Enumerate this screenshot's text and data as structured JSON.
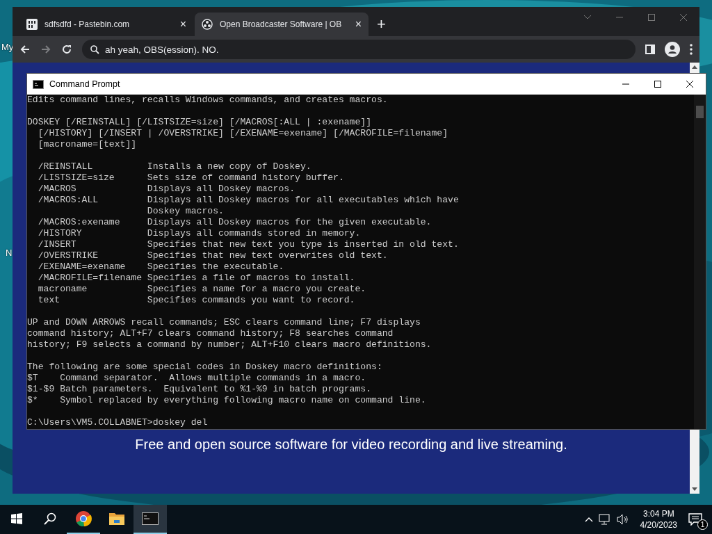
{
  "desktop": {
    "icon_labels": [
      "My",
      "N"
    ]
  },
  "browser": {
    "tabs": [
      {
        "title": "sdfsdfd - Pastebin.com",
        "selected": false,
        "close": "×"
      },
      {
        "title": "Open Broadcaster Software | OB",
        "selected": true,
        "close": "×"
      }
    ],
    "new_tab": "+",
    "address": {
      "value": "ah yeah, OBS(ession). NO."
    },
    "page": {
      "tagline": "Free and open source software for video recording and live streaming."
    }
  },
  "cmd": {
    "title": "Command Prompt",
    "blocks": [
      [
        "Edits command lines, recalls Windows commands, and creates macros."
      ],
      [
        "DOSKEY [/REINSTALL] [/LISTSIZE=size] [/MACROS[:ALL | :exename]]",
        "  [/HISTORY] [/INSERT | /OVERSTRIKE] [/EXENAME=exename] [/MACROFILE=filename]",
        "  [macroname=[text]]"
      ],
      [
        "  /REINSTALL          Installs a new copy of Doskey.",
        "  /LISTSIZE=size      Sets size of command history buffer.",
        "  /MACROS             Displays all Doskey macros.",
        "  /MACROS:ALL         Displays all Doskey macros for all executables which have",
        "                      Doskey macros.",
        "  /MACROS:exename     Displays all Doskey macros for the given executable.",
        "  /HISTORY            Displays all commands stored in memory.",
        "  /INSERT             Specifies that new text you type is inserted in old text.",
        "  /OVERSTRIKE         Specifies that new text overwrites old text.",
        "  /EXENAME=exename    Specifies the executable.",
        "  /MACROFILE=filename Specifies a file of macros to install.",
        "  macroname           Specifies a name for a macro you create.",
        "  text                Specifies commands you want to record."
      ],
      [
        "UP and DOWN ARROWS recall commands; ESC clears command line; F7 displays",
        "command history; ALT+F7 clears command history; F8 searches command",
        "history; F9 selects a command by number; ALT+F10 clears macro definitions."
      ],
      [
        "The following are some special codes in Doskey macro definitions:",
        "$T    Command separator.  Allows multiple commands in a macro.",
        "$1-$9 Batch parameters.  Equivalent to %1-%9 in batch programs.",
        "$*    Symbol replaced by everything following macro name on command line."
      ],
      [
        "C:\\Users\\VM5.COLLABNET>doskey del"
      ]
    ]
  },
  "taskbar": {
    "apps": [
      {
        "kind": "chrome",
        "running": true,
        "active": false
      },
      {
        "kind": "explorer",
        "running": false,
        "active": false
      },
      {
        "kind": "console",
        "running": true,
        "active": true
      }
    ],
    "time": "3:04 PM",
    "date": "4/20/2023",
    "notifications": "1"
  }
}
